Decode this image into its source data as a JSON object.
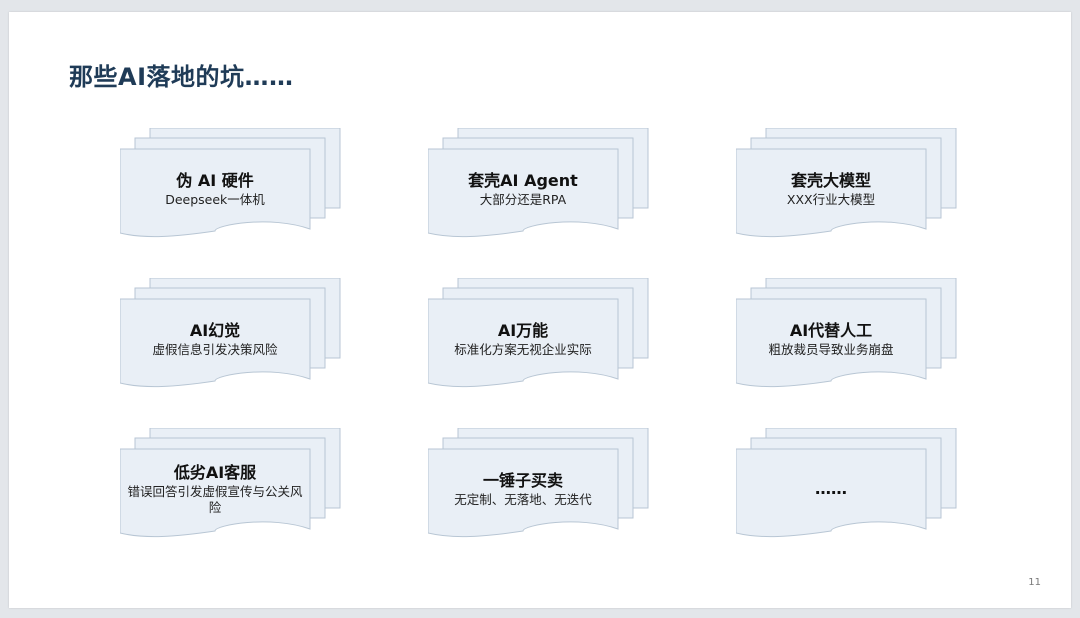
{
  "slide": {
    "title": "那些AI落地的坑……",
    "page_number": "11",
    "colors": {
      "title": "#1f3b57",
      "card_fill": "#e9eff6",
      "card_stroke": "#b8c6d4"
    }
  },
  "cards": [
    {
      "title": "伪 AI 硬件",
      "subtitle": "Deepseek一体机"
    },
    {
      "title": "套壳AI Agent",
      "subtitle": "大部分还是RPA"
    },
    {
      "title": "套壳大模型",
      "subtitle": "XXX行业大模型"
    },
    {
      "title": "AI幻觉",
      "subtitle": "虚假信息引发决策风险"
    },
    {
      "title": "AI万能",
      "subtitle": "标准化方案无视企业实际"
    },
    {
      "title": "AI代替人工",
      "subtitle": "粗放裁员导致业务崩盘"
    },
    {
      "title": "低劣AI客服",
      "subtitle": "错误回答引发虚假宣传与公关风险"
    },
    {
      "title": "一锤子买卖",
      "subtitle": "无定制、无落地、无迭代"
    },
    {
      "title": "……",
      "subtitle": ""
    }
  ]
}
